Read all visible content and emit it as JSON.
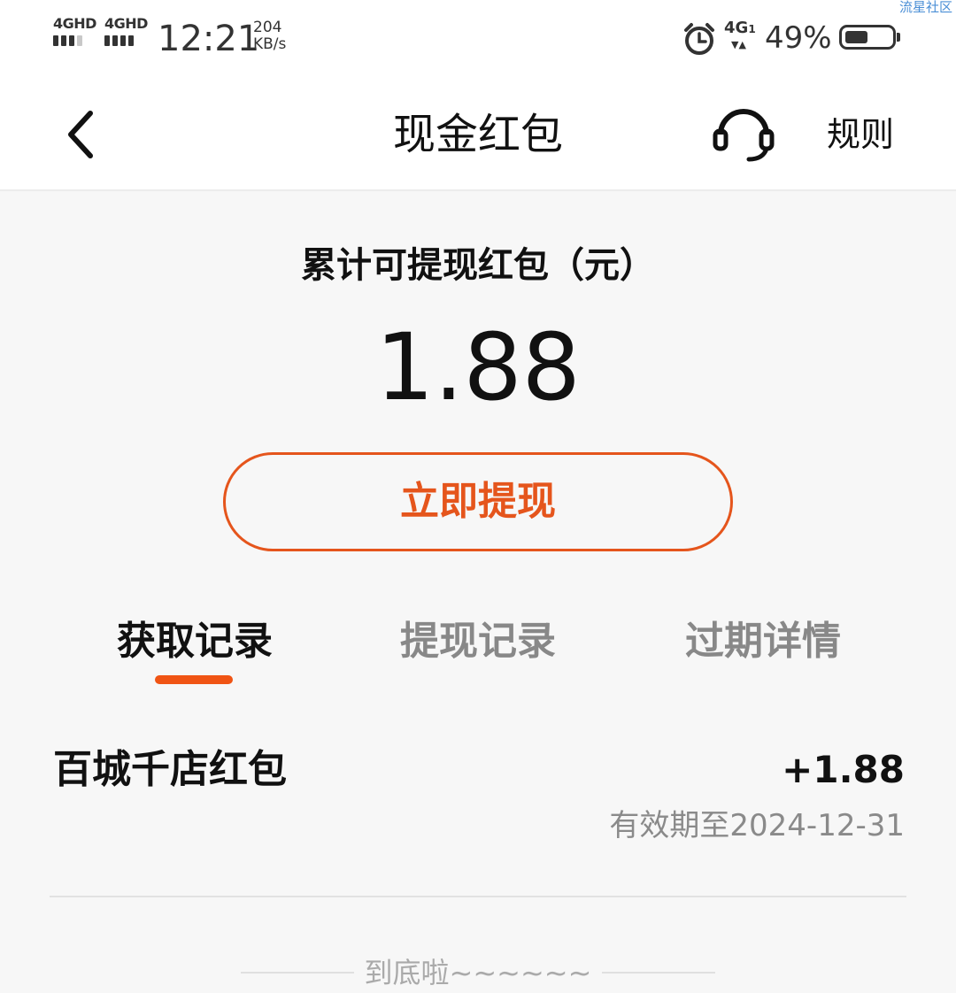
{
  "status_bar": {
    "sim1_label": "4GHD",
    "sim2_label": "4GHD",
    "time": "12:21",
    "net_speed_value": "204",
    "net_speed_unit": "KB/s",
    "net_type": "4G",
    "net_sub": "1",
    "battery_percent": "49%",
    "battery_level": 0.49,
    "watermark": "流星社区"
  },
  "nav": {
    "title": "现金红包",
    "rules_label": "规则",
    "back_icon": "chevron-left-icon",
    "service_icon": "headset-icon"
  },
  "balance": {
    "label": "累计可提现红包（元）",
    "amount": "1.88",
    "withdraw_label": "立即提现"
  },
  "tabs": [
    {
      "label": "获取记录",
      "active": true
    },
    {
      "label": "提现记录",
      "active": false
    },
    {
      "label": "过期详情",
      "active": false
    }
  ],
  "records": [
    {
      "title": "百城千店红包",
      "amount": "+1.88",
      "expiry": "有效期至2024-12-31"
    }
  ],
  "end_text": "到底啦~~~~~~",
  "colors": {
    "accent": "#e5551c",
    "tab_indicator": "#f05414",
    "background": "#f7f7f7",
    "muted_text": "#8a8a8a"
  }
}
